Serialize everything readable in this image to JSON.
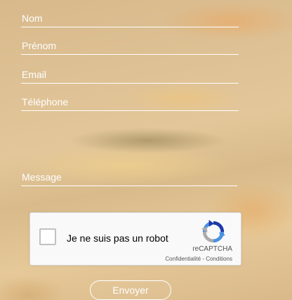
{
  "form": {
    "fields": {
      "nom": "Nom",
      "prenom": "Prénom",
      "email": "Email",
      "telephone": "Téléphone",
      "message": "Message"
    },
    "recaptcha": {
      "checkbox_label": "Je ne suis pas un robot",
      "brand": "reCAPTCHA",
      "legal": "Confidentialité - Conditions",
      "checked": false
    },
    "submit_label": "Envoyer"
  },
  "icons": {
    "recaptcha_logo": "recaptcha-logo-icon"
  },
  "colors": {
    "field_text": "#ffffff",
    "recaptcha_blue": "#1c3aa9",
    "recaptcha_lightblue": "#4a90e2",
    "recaptcha_gray": "#ababab"
  }
}
